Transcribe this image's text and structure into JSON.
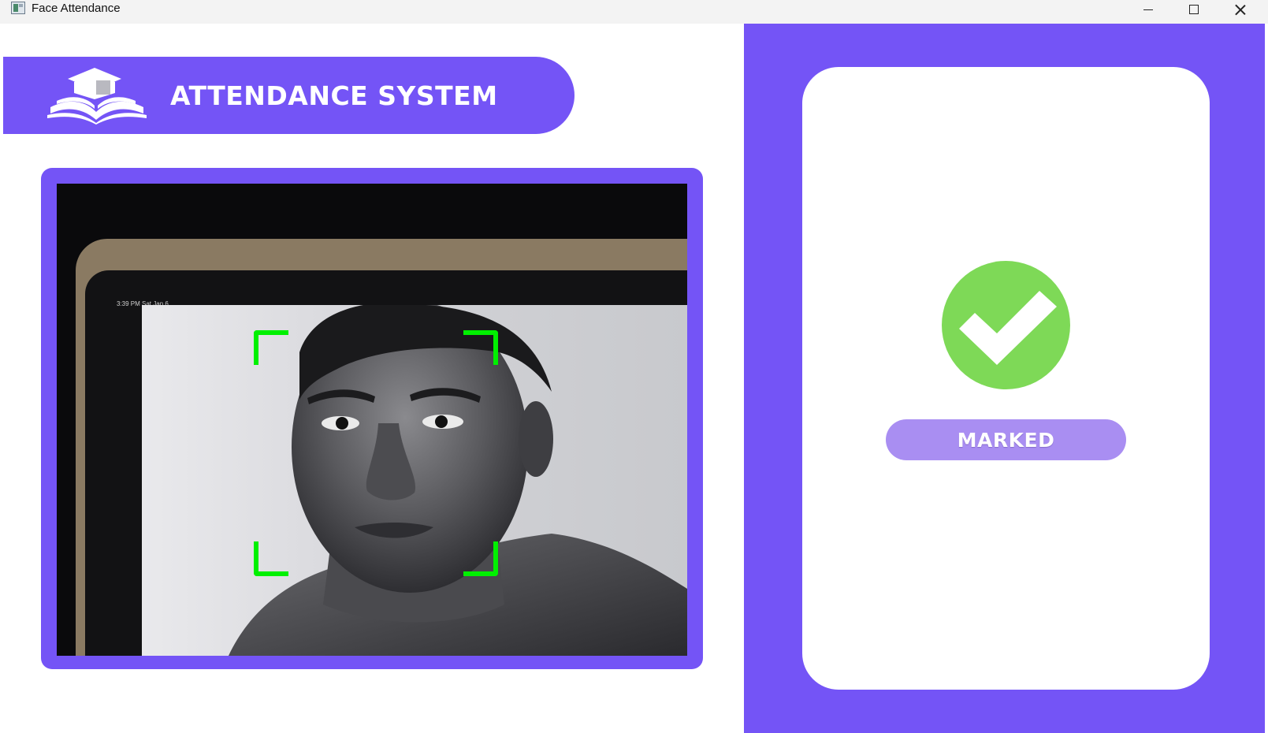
{
  "window": {
    "title": "Face Attendance",
    "icon": "app-window-icon",
    "controls": [
      "minimize-icon",
      "maximize-icon",
      "close-icon"
    ]
  },
  "header": {
    "title": "ATTENDANCE SYSTEM",
    "logo_icon": "graduation-cap-book-icon"
  },
  "camera": {
    "overlay_icon": "face-detection-frame-corners",
    "overlay_color": "#00f000",
    "status_bar_text": "3:39 PM  Sat Jan 6"
  },
  "status": {
    "icon": "checkmark-circle-icon",
    "label": "MARKED",
    "icon_color": "#7ed957"
  },
  "colors": {
    "accent": "#7454f6",
    "pill": "#a98ef2",
    "success": "#7ed957"
  }
}
